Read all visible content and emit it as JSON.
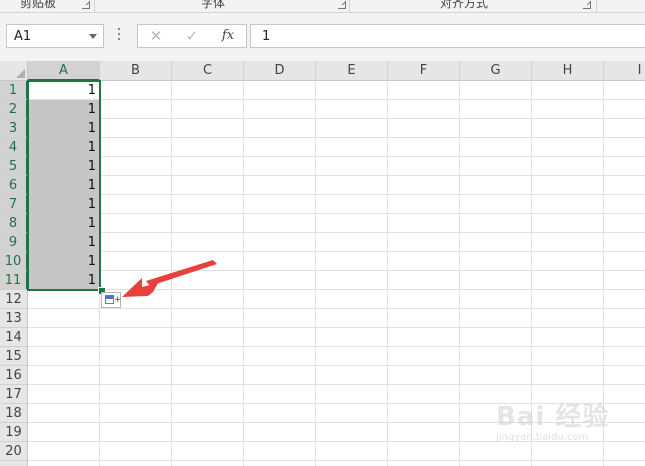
{
  "ribbon": {
    "groups": [
      {
        "label": "剪贴板"
      },
      {
        "label": "字体"
      },
      {
        "label": "对齐方式"
      }
    ]
  },
  "formula_bar": {
    "name_box": "A1",
    "cancel_icon": "✕",
    "enter_icon": "✓",
    "fx_label": "fx",
    "formula_value": "1"
  },
  "sheet": {
    "columns": [
      "A",
      "B",
      "C",
      "D",
      "E",
      "F",
      "G",
      "H",
      "I"
    ],
    "rows": [
      "1",
      "2",
      "3",
      "4",
      "5",
      "6",
      "7",
      "8",
      "9",
      "10",
      "11",
      "12",
      "13",
      "14",
      "15",
      "16",
      "17",
      "18",
      "19",
      "20"
    ],
    "column_a_values": [
      "1",
      "1",
      "1",
      "1",
      "1",
      "1",
      "1",
      "1",
      "1",
      "1",
      "1"
    ],
    "selection": "A1:A11",
    "accent_color": "#217346"
  },
  "annotation": {
    "arrow_color": "#e8403a"
  },
  "watermark": {
    "brand": "Bai 经验",
    "sub": "jingyan.baidu.com"
  }
}
